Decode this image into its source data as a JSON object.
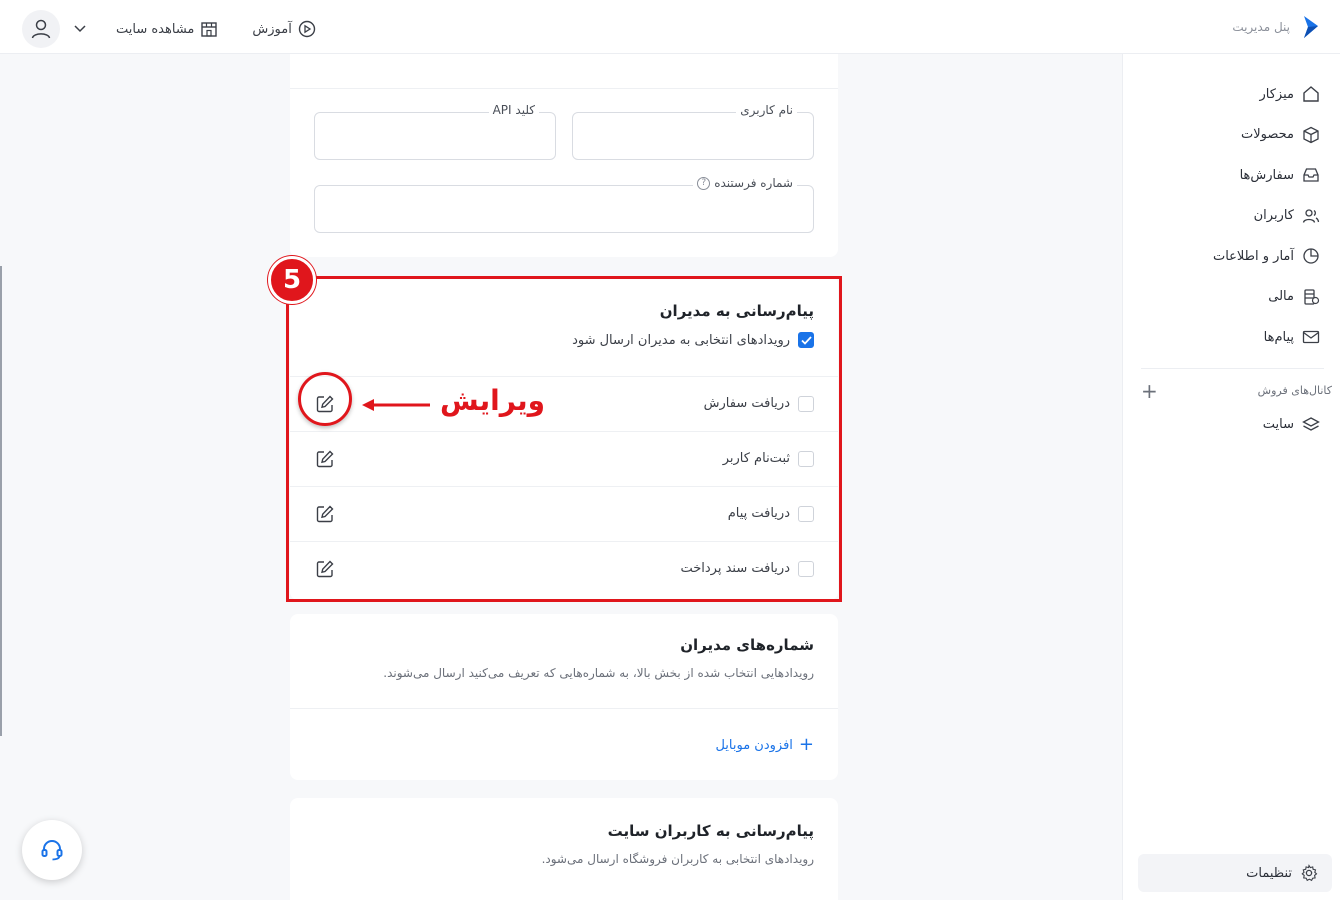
{
  "colors": {
    "accent": "#1a73e8",
    "annotation_red": "#e0161c"
  },
  "header": {
    "brand_text": "پنل مدیریت",
    "view_site_label": "مشاهده سایت",
    "learn_label": "آموزش"
  },
  "sidebar": {
    "items": [
      {
        "label": "میزکار",
        "icon": "home-icon"
      },
      {
        "label": "محصولات",
        "icon": "box-icon"
      },
      {
        "label": "سفارش‌ها",
        "icon": "inbox-icon"
      },
      {
        "label": "کاربران",
        "icon": "users-icon"
      },
      {
        "label": "آمار و اطلاعات",
        "icon": "pie-chart-icon"
      },
      {
        "label": "مالی",
        "icon": "finance-icon"
      },
      {
        "label": "پیام‌ها",
        "icon": "mail-icon"
      }
    ],
    "channels_label": "کانال‌های فروش",
    "site_label": "سایت",
    "settings_label": "تنظیمات"
  },
  "sms_settings": {
    "username_label": "نام کاربری",
    "username_value": "",
    "api_key_label": "کلید API",
    "api_key_value": "",
    "sender_number_label": "شماره فرستنده",
    "sender_number_value": ""
  },
  "admin_messaging": {
    "title": "پیام‌رسانی به مدیران",
    "main_check_label": "رویدادهای انتخابی به مدیران ارسال شود",
    "main_checked": true,
    "events": [
      {
        "label": "دریافت سفارش",
        "checked": false
      },
      {
        "label": "ثبت‌نام کاربر",
        "checked": false
      },
      {
        "label": "دریافت پیام",
        "checked": false
      },
      {
        "label": "دریافت سند پرداخت",
        "checked": false
      }
    ]
  },
  "annotation": {
    "badge": "5",
    "label": "ویرایش"
  },
  "admin_numbers": {
    "title": "شماره‌های مدیران",
    "description": "رویدادهایی انتخاب شده از بخش بالا، به شماره‌هایی که تعریف می‌کنید ارسال می‌شوند.",
    "add_label": "افزودن موبایل"
  },
  "user_messaging": {
    "title": "پیام‌رسانی به کاربران سایت",
    "description": "رویدادهای انتخابی به کاربران فروشگاه ارسال می‌شود."
  }
}
